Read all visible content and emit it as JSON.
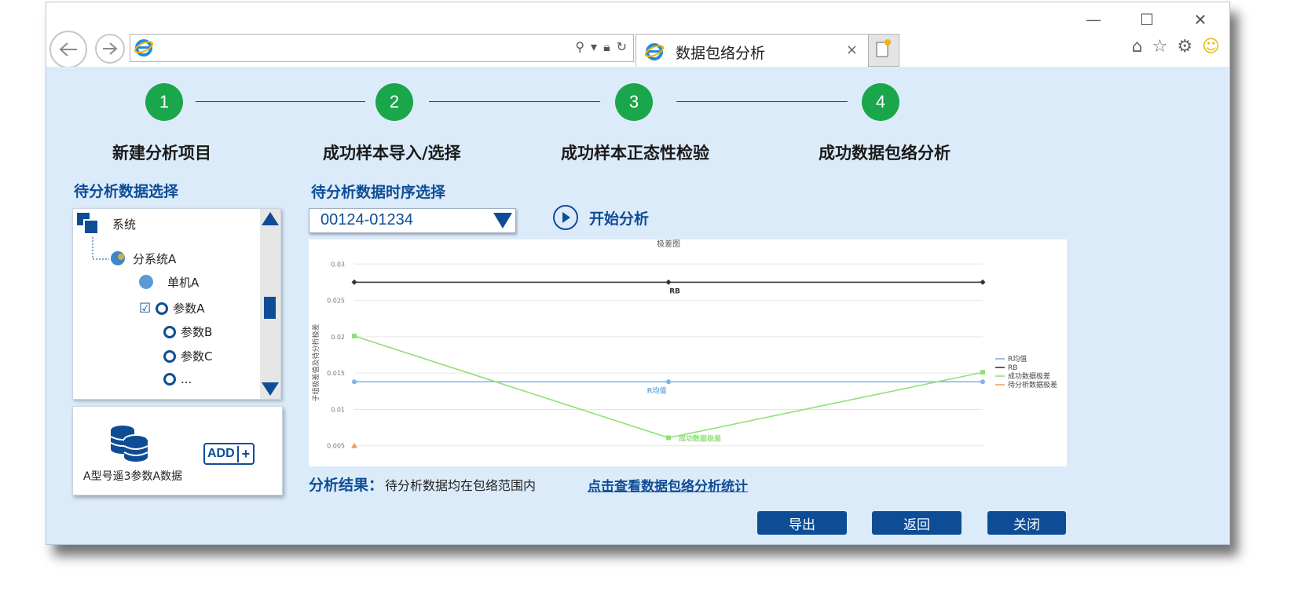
{
  "browser": {
    "tab_title": "数据包络分析",
    "tab_close": "×",
    "address_value": "",
    "win_controls": [
      "—",
      "☐",
      "✕"
    ],
    "toolbar_icons": [
      "home-icon",
      "star-icon",
      "gear-icon",
      "smiley-icon"
    ]
  },
  "steps": [
    {
      "number": "1",
      "label": "新建分析项目"
    },
    {
      "number": "2",
      "label": "成功样本导入/选择"
    },
    {
      "number": "3",
      "label": "成功样本正态性检验"
    },
    {
      "number": "4",
      "label": "成功数据包络分析"
    }
  ],
  "left_panel": {
    "title": "待分析数据选择",
    "tree": {
      "root": "系统",
      "subsystem": "分系统A",
      "unit": "单机A",
      "params": [
        "参数A",
        "参数B",
        "参数C",
        "..."
      ],
      "checked_param": "参数A"
    },
    "dataset_label": "A型号遥3参数A数据",
    "add_label": "ADD",
    "add_plus": "+"
  },
  "center": {
    "title": "待分析数据时序选择",
    "select_value": "00124-01234",
    "start_label": "开始分析"
  },
  "chart_data": {
    "type": "line",
    "title": "极差图",
    "ylabel": "子组极差值及待分析极差",
    "xlabel": "",
    "ylim": [
      0.004,
      0.031
    ],
    "yticks": [
      "0.03",
      "0.025",
      "0.02",
      "0.015",
      "0.01",
      "0.005"
    ],
    "x": [
      1,
      2,
      3
    ],
    "series": [
      {
        "name": "R均值",
        "color": "#7fb2e5",
        "marker": "circle",
        "values": [
          0.0138,
          0.0138,
          0.0138
        ],
        "label": "R均值",
        "label_index": 1
      },
      {
        "name": "RB",
        "color": "#333333",
        "marker": "diamond",
        "values": [
          0.0275,
          0.0275,
          0.0275
        ],
        "label": "RB",
        "label_index": 1
      },
      {
        "name": "成功数据极差",
        "color": "#90e07a",
        "marker": "square",
        "values": [
          0.0201,
          0.0061,
          0.0151
        ],
        "label": "成功数据极差",
        "label_index": 1
      },
      {
        "name": "待分析数据极差",
        "color": "#f0a060",
        "marker": "triangle",
        "values": [
          0.005,
          null,
          null
        ],
        "label": "",
        "label_index": null
      }
    ],
    "legend": "right",
    "grid": true
  },
  "result": {
    "label": "分析结果：",
    "text": "待分析数据均在包络范围内",
    "link": "点击查看数据包络分析统计"
  },
  "buttons": {
    "export": "导出",
    "back": "返回",
    "close": "关闭"
  }
}
